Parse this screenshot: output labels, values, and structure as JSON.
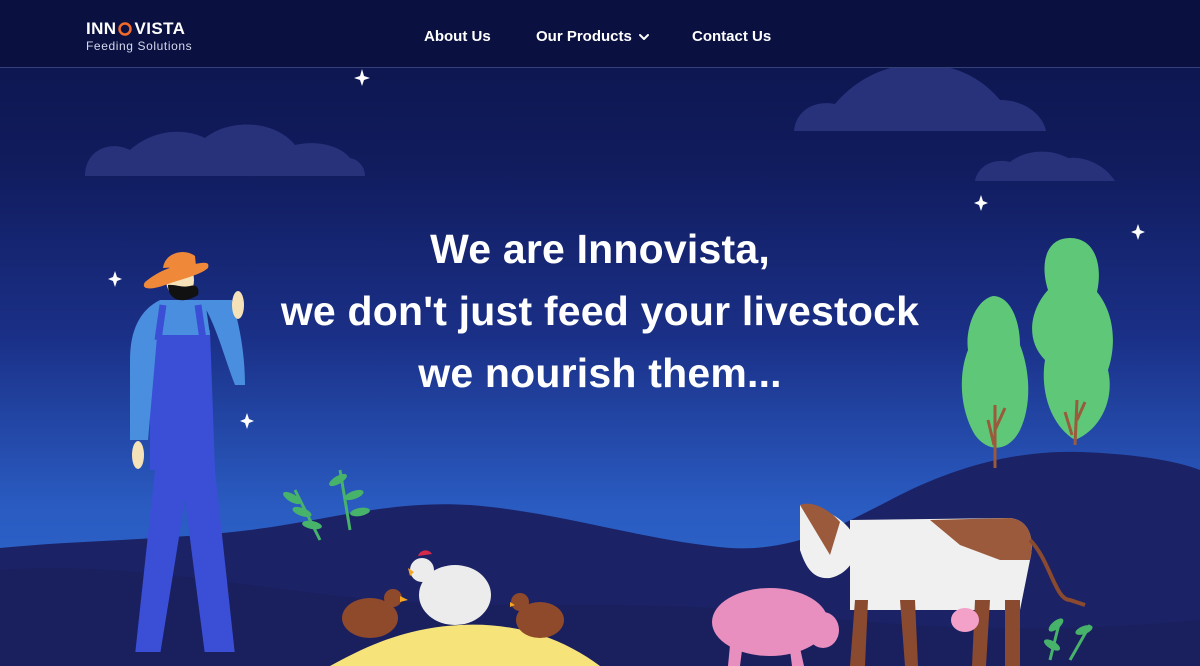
{
  "header": {
    "logo": {
      "brand_part1": "INN",
      "brand_part2": "VISTA",
      "tagline": "Feeding Solutions"
    },
    "nav": [
      {
        "label": "About Us"
      },
      {
        "label": "Our Products",
        "icon": "chevron-down-icon"
      },
      {
        "label": "Contact Us"
      }
    ]
  },
  "hero": {
    "lines": [
      "We are Innovista,",
      "we don't just feed your livestock",
      "we nourish them..."
    ]
  },
  "colors": {
    "nav_background": "#0a1141",
    "accent_orange": "#f06a2a",
    "text": "#ffffff"
  }
}
